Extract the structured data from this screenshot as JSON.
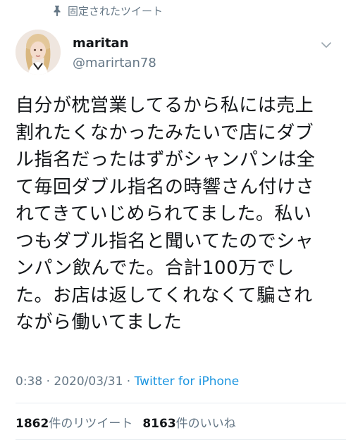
{
  "pinned": {
    "label": "固定されたツイート",
    "icon": "pin-icon"
  },
  "author": {
    "display_name": "maritan",
    "handle": "@marirtan78",
    "avatar": "avatar"
  },
  "tweet": {
    "text": "自分が枕営業してるから私には売上\n割れたくなかったみたいで店にダブ\nル指名だったはずがシャンパンは全\nて毎回ダブル指名の時響さん付けさ\nれてきていじめられてました。私い\nつもダブル指名と聞いてたのでシャ\nンパン飲んでた。合計100万でし\nた。お店は返してくれなくて騙され\nながら働いてました"
  },
  "meta": {
    "time": "0:38",
    "sep1": "·",
    "date": "2020/03/31",
    "sep2": "·",
    "source": "Twitter for iPhone"
  },
  "stats": {
    "retweets_count": "1862",
    "retweets_label": "件のリツイート",
    "likes_count": "8163",
    "likes_label": "件のいいね"
  },
  "colors": {
    "text": "#14171a",
    "secondary": "#657786",
    "link": "#1b95e0",
    "divider": "#e6ecf0"
  }
}
